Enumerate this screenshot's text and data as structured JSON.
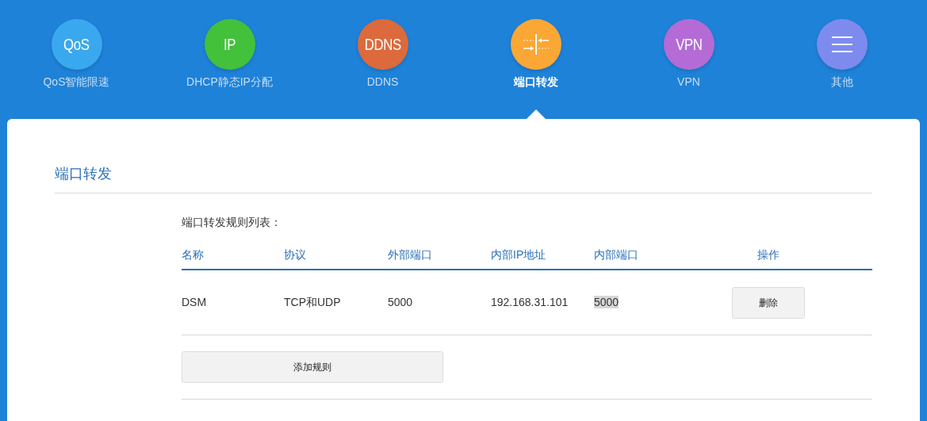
{
  "nav": [
    {
      "label": "QoS智能限速",
      "kind": "text",
      "icon_text": "QoS",
      "color": "#3aa8ee",
      "selected": false
    },
    {
      "label": "DHCP静态IP分配",
      "kind": "text",
      "icon_text": "IP",
      "color": "#43c13a",
      "selected": false
    },
    {
      "label": "DDNS",
      "kind": "text",
      "icon_text": "DDNS",
      "color": "#dc6a3c",
      "selected": false
    },
    {
      "label": "端口转发",
      "kind": "arrows",
      "color": "#fba735",
      "selected": true
    },
    {
      "label": "VPN",
      "kind": "text",
      "icon_text": "VPN",
      "color": "#b46bd6",
      "selected": false
    },
    {
      "label": "其他",
      "kind": "menu",
      "color": "#7d8bee",
      "selected": false
    }
  ],
  "panel": {
    "title": "端口转发",
    "list_title": "端口转发规则列表：",
    "columns": [
      "名称",
      "协议",
      "外部端口",
      "内部IP地址",
      "内部端口",
      "操作"
    ],
    "rows": [
      {
        "cells": [
          {
            "text": "DSM",
            "highlighted": false
          },
          {
            "text": "TCP和UDP",
            "highlighted": false
          },
          {
            "text": "5000",
            "highlighted": false
          },
          {
            "text": "192.168.31.101",
            "highlighted": false
          },
          {
            "text": "5000",
            "highlighted": true
          }
        ],
        "action": "删除"
      }
    ],
    "add_button": "添加规则"
  }
}
